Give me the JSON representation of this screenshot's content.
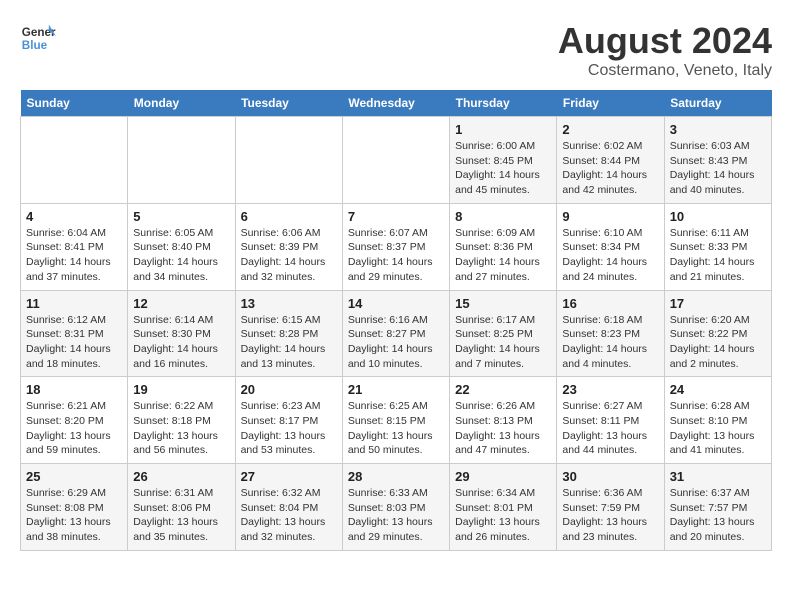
{
  "header": {
    "logo_line1": "General",
    "logo_line2": "Blue",
    "main_title": "August 2024",
    "subtitle": "Costermano, Veneto, Italy"
  },
  "days_of_week": [
    "Sunday",
    "Monday",
    "Tuesday",
    "Wednesday",
    "Thursday",
    "Friday",
    "Saturday"
  ],
  "weeks": [
    [
      {
        "day": "",
        "info": ""
      },
      {
        "day": "",
        "info": ""
      },
      {
        "day": "",
        "info": ""
      },
      {
        "day": "",
        "info": ""
      },
      {
        "day": "1",
        "info": "Sunrise: 6:00 AM\nSunset: 8:45 PM\nDaylight: 14 hours and 45 minutes."
      },
      {
        "day": "2",
        "info": "Sunrise: 6:02 AM\nSunset: 8:44 PM\nDaylight: 14 hours and 42 minutes."
      },
      {
        "day": "3",
        "info": "Sunrise: 6:03 AM\nSunset: 8:43 PM\nDaylight: 14 hours and 40 minutes."
      }
    ],
    [
      {
        "day": "4",
        "info": "Sunrise: 6:04 AM\nSunset: 8:41 PM\nDaylight: 14 hours and 37 minutes."
      },
      {
        "day": "5",
        "info": "Sunrise: 6:05 AM\nSunset: 8:40 PM\nDaylight: 14 hours and 34 minutes."
      },
      {
        "day": "6",
        "info": "Sunrise: 6:06 AM\nSunset: 8:39 PM\nDaylight: 14 hours and 32 minutes."
      },
      {
        "day": "7",
        "info": "Sunrise: 6:07 AM\nSunset: 8:37 PM\nDaylight: 14 hours and 29 minutes."
      },
      {
        "day": "8",
        "info": "Sunrise: 6:09 AM\nSunset: 8:36 PM\nDaylight: 14 hours and 27 minutes."
      },
      {
        "day": "9",
        "info": "Sunrise: 6:10 AM\nSunset: 8:34 PM\nDaylight: 14 hours and 24 minutes."
      },
      {
        "day": "10",
        "info": "Sunrise: 6:11 AM\nSunset: 8:33 PM\nDaylight: 14 hours and 21 minutes."
      }
    ],
    [
      {
        "day": "11",
        "info": "Sunrise: 6:12 AM\nSunset: 8:31 PM\nDaylight: 14 hours and 18 minutes."
      },
      {
        "day": "12",
        "info": "Sunrise: 6:14 AM\nSunset: 8:30 PM\nDaylight: 14 hours and 16 minutes."
      },
      {
        "day": "13",
        "info": "Sunrise: 6:15 AM\nSunset: 8:28 PM\nDaylight: 14 hours and 13 minutes."
      },
      {
        "day": "14",
        "info": "Sunrise: 6:16 AM\nSunset: 8:27 PM\nDaylight: 14 hours and 10 minutes."
      },
      {
        "day": "15",
        "info": "Sunrise: 6:17 AM\nSunset: 8:25 PM\nDaylight: 14 hours and 7 minutes."
      },
      {
        "day": "16",
        "info": "Sunrise: 6:18 AM\nSunset: 8:23 PM\nDaylight: 14 hours and 4 minutes."
      },
      {
        "day": "17",
        "info": "Sunrise: 6:20 AM\nSunset: 8:22 PM\nDaylight: 14 hours and 2 minutes."
      }
    ],
    [
      {
        "day": "18",
        "info": "Sunrise: 6:21 AM\nSunset: 8:20 PM\nDaylight: 13 hours and 59 minutes."
      },
      {
        "day": "19",
        "info": "Sunrise: 6:22 AM\nSunset: 8:18 PM\nDaylight: 13 hours and 56 minutes."
      },
      {
        "day": "20",
        "info": "Sunrise: 6:23 AM\nSunset: 8:17 PM\nDaylight: 13 hours and 53 minutes."
      },
      {
        "day": "21",
        "info": "Sunrise: 6:25 AM\nSunset: 8:15 PM\nDaylight: 13 hours and 50 minutes."
      },
      {
        "day": "22",
        "info": "Sunrise: 6:26 AM\nSunset: 8:13 PM\nDaylight: 13 hours and 47 minutes."
      },
      {
        "day": "23",
        "info": "Sunrise: 6:27 AM\nSunset: 8:11 PM\nDaylight: 13 hours and 44 minutes."
      },
      {
        "day": "24",
        "info": "Sunrise: 6:28 AM\nSunset: 8:10 PM\nDaylight: 13 hours and 41 minutes."
      }
    ],
    [
      {
        "day": "25",
        "info": "Sunrise: 6:29 AM\nSunset: 8:08 PM\nDaylight: 13 hours and 38 minutes."
      },
      {
        "day": "26",
        "info": "Sunrise: 6:31 AM\nSunset: 8:06 PM\nDaylight: 13 hours and 35 minutes."
      },
      {
        "day": "27",
        "info": "Sunrise: 6:32 AM\nSunset: 8:04 PM\nDaylight: 13 hours and 32 minutes."
      },
      {
        "day": "28",
        "info": "Sunrise: 6:33 AM\nSunset: 8:03 PM\nDaylight: 13 hours and 29 minutes."
      },
      {
        "day": "29",
        "info": "Sunrise: 6:34 AM\nSunset: 8:01 PM\nDaylight: 13 hours and 26 minutes."
      },
      {
        "day": "30",
        "info": "Sunrise: 6:36 AM\nSunset: 7:59 PM\nDaylight: 13 hours and 23 minutes."
      },
      {
        "day": "31",
        "info": "Sunrise: 6:37 AM\nSunset: 7:57 PM\nDaylight: 13 hours and 20 minutes."
      }
    ]
  ]
}
